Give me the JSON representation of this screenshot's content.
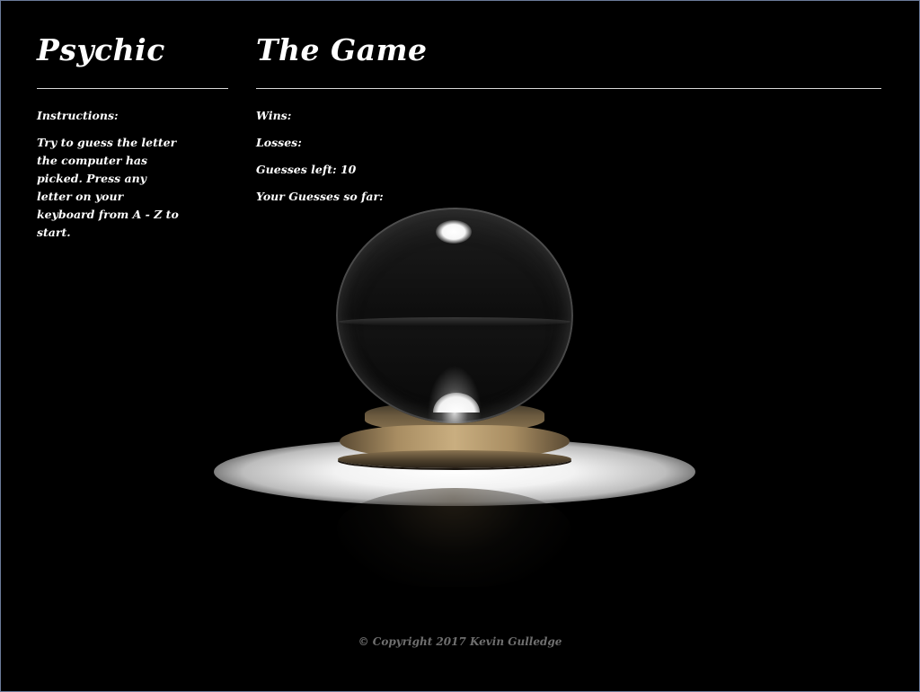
{
  "left_column": {
    "title": "Psychic",
    "instructions_label": "Instructions:",
    "instructions_text": "Try to guess the letter the computer has picked. Press any letter on your keyboard from A - Z to start."
  },
  "right_column": {
    "title": "The Game",
    "wins_label": "Wins:",
    "losses_label": "Losses:",
    "guesses_left_label": "Guesses left: 10",
    "guesses_so_far_label": "Your Guesses so far:"
  },
  "footer": {
    "copyright": "© Copyright 2017 Kevin Gulledge"
  },
  "colors": {
    "background": "#000000",
    "text": "#ffffff",
    "footer_text": "#6f6f6f",
    "rule": "#d8d8d8"
  },
  "icons": {
    "scene": "crystal-ball-image"
  }
}
